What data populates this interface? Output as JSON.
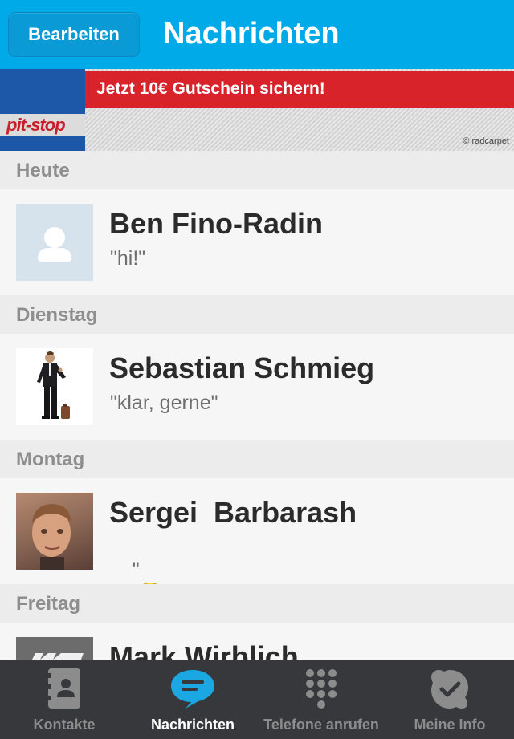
{
  "header": {
    "edit_label": "Bearbeiten",
    "title": "Nachrichten",
    "bg_color": "#00a9e8"
  },
  "ad": {
    "logo_text": "pit-stop",
    "headline": "Jetzt 10€ Gutschein sichern!",
    "credit": "© radcarpet"
  },
  "conversations": [
    {
      "section": "Heute",
      "name": "Ben Fino-Radin",
      "message": "\"hi!\"",
      "avatar": "default-avatar-icon"
    },
    {
      "section": "Dienstag",
      "name": "Sebastian Schmieg",
      "message": "\"klar, gerne\"",
      "avatar": "man-in-suit-avatar"
    },
    {
      "section": "Montag",
      "name": "Sergei  Barbarash",
      "message_prefix": "\"",
      "message_suffix": "\"",
      "message_emoticon": "smiley-emoticon",
      "avatar": "photo-avatar"
    },
    {
      "section": "Freitag",
      "name": "Mark Wirblich",
      "avatar": "mw-logo-avatar"
    }
  ],
  "tabbar": {
    "tabs": [
      {
        "label": "Kontakte",
        "icon": "contacts-book-icon",
        "active": false
      },
      {
        "label": "Nachrichten",
        "icon": "chat-bubble-icon",
        "active": true
      },
      {
        "label": "Telefone anrufen",
        "icon": "dialpad-icon",
        "active": false
      },
      {
        "label": "Meine Info",
        "icon": "skype-check-icon",
        "active": false
      }
    ],
    "active_color": "#1ba7e1"
  }
}
